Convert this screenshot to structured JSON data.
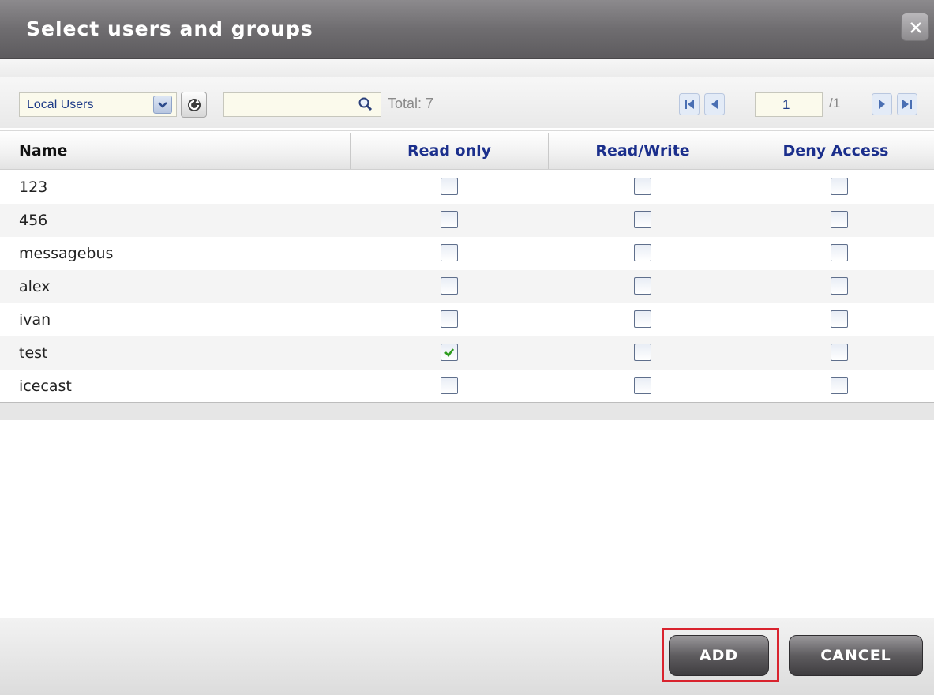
{
  "dialog": {
    "title": "Select users and groups"
  },
  "toolbar": {
    "source_select_value": "Local Users",
    "search_placeholder": "",
    "total_label": "Total: 7",
    "current_page": "1",
    "page_total": "/1"
  },
  "table": {
    "columns": [
      "Name",
      "Read only",
      "Read/Write",
      "Deny Access"
    ],
    "rows": [
      {
        "name": "123",
        "read_only": false,
        "read_write": false,
        "deny_access": false
      },
      {
        "name": "456",
        "read_only": false,
        "read_write": false,
        "deny_access": false
      },
      {
        "name": "messagebus",
        "read_only": false,
        "read_write": false,
        "deny_access": false
      },
      {
        "name": "alex",
        "read_only": false,
        "read_write": false,
        "deny_access": false
      },
      {
        "name": "ivan",
        "read_only": false,
        "read_write": false,
        "deny_access": false
      },
      {
        "name": "test",
        "read_only": true,
        "read_write": false,
        "deny_access": false
      },
      {
        "name": "icecast",
        "read_only": false,
        "read_write": false,
        "deny_access": false
      }
    ]
  },
  "footer": {
    "add_label": "ADD",
    "cancel_label": "CANCEL"
  },
  "colors": {
    "header_text_dark": "#111111",
    "header_text_accent": "#1b2f8c",
    "check_green": "#2e9c1e",
    "highlight_red": "#d9232e"
  },
  "icons": [
    "close-icon",
    "chevron-down-icon",
    "refresh-icon",
    "search-icon",
    "first-page-icon",
    "prev-page-icon",
    "next-page-icon",
    "last-page-icon",
    "checkmark-icon"
  ]
}
